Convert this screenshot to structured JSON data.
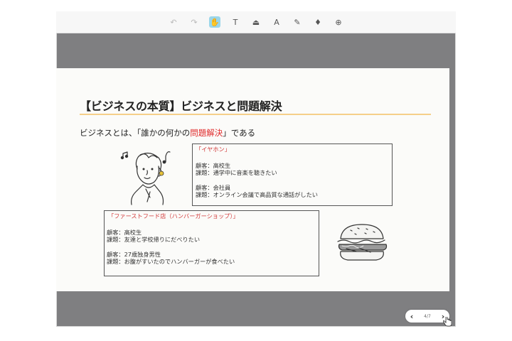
{
  "toolbar": {
    "tools": [
      {
        "name": "undo-icon",
        "glyph": "↶"
      },
      {
        "name": "redo-icon",
        "glyph": "↷"
      },
      {
        "name": "hand-tool-icon",
        "glyph": "✋"
      },
      {
        "name": "text-tool-icon",
        "glyph": "T"
      },
      {
        "name": "stamp-tool-icon",
        "glyph": "⏏"
      },
      {
        "name": "highlight-text-icon",
        "glyph": "A"
      },
      {
        "name": "draw-tool-icon",
        "glyph": "✎"
      },
      {
        "name": "microphone-icon",
        "glyph": "♦"
      },
      {
        "name": "zoom-icon",
        "glyph": "⊕"
      }
    ]
  },
  "slide": {
    "title": "【ビジネスの本質】ビジネスと問題解決",
    "lead_before": "ビジネスとは、「誰かの何かの",
    "lead_highlight": "問題解決",
    "lead_after": "」である",
    "box1": {
      "heading": "「イヤホン」",
      "group1_line1": "顧客：高校生",
      "group1_line2": "課題：通学中に音楽を聴きたい",
      "group2_line1": "顧客：会社員",
      "group2_line2": "課題：オンライン会議で高品質な通話がしたい"
    },
    "box2": {
      "heading": "「ファーストフード店（ハンバーガーショップ）」",
      "group1_line1": "顧客：高校生",
      "group1_line2": "課題：友達と学校帰りにだべりたい",
      "group2_line1": "顧客：27歳独身男性",
      "group2_line2": "課題：お腹がすいたのでハンバーガーが食べたい"
    }
  },
  "pager": {
    "prev": "‹",
    "next": "›",
    "count": "4/7"
  },
  "colors": {
    "highlight_red": "#e02a2a",
    "title_rule": "#f5cf8a",
    "active_tool": "#9ad6ea"
  }
}
